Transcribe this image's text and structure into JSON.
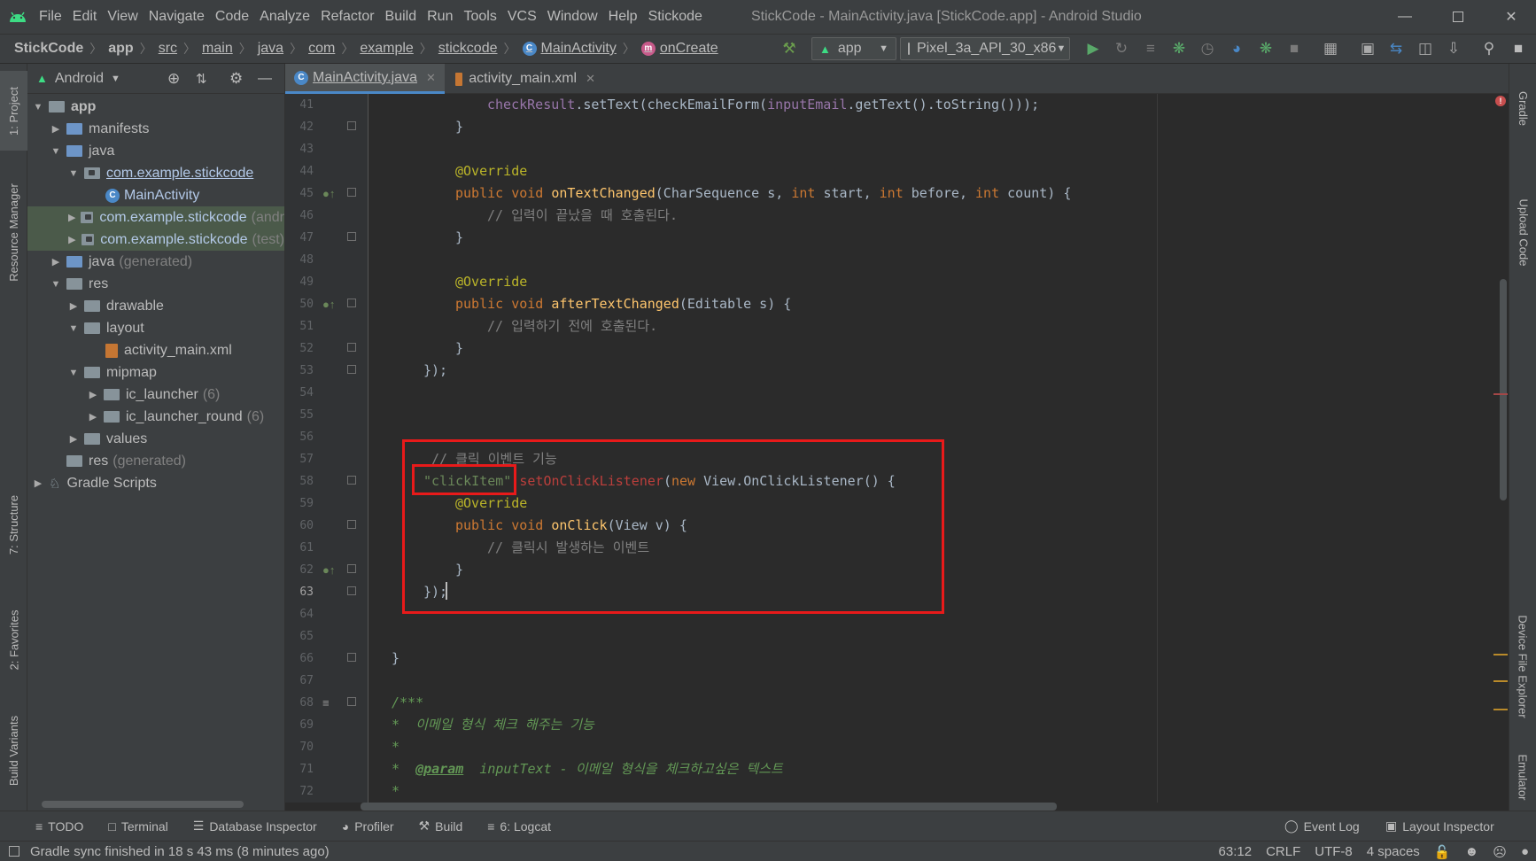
{
  "menubar": {
    "items": [
      "File",
      "Edit",
      "View",
      "Navigate",
      "Code",
      "Analyze",
      "Refactor",
      "Build",
      "Run",
      "Tools",
      "VCS",
      "Window",
      "Help",
      "Stickode"
    ],
    "window_title": "StickCode - MainActivity.java [StickCode.app] - Android Studio"
  },
  "breadcrumb": {
    "items": [
      "StickCode",
      "app",
      "src",
      "main",
      "java",
      "com",
      "example",
      "stickcode",
      "MainActivity",
      "onCreate"
    ]
  },
  "toolbar": {
    "run_config": "app",
    "device": "Pixel_3a_API_30_x86"
  },
  "project_panel": {
    "view_mode": "Android",
    "tree": [
      {
        "label": "app",
        "extra": ""
      },
      {
        "label": "manifests",
        "extra": ""
      },
      {
        "label": "java",
        "extra": ""
      },
      {
        "label": "com.example.stickcode",
        "extra": ""
      },
      {
        "label": "MainActivity",
        "extra": ""
      },
      {
        "label": "com.example.stickcode",
        "extra": "(andr"
      },
      {
        "label": "com.example.stickcode",
        "extra": "(test)"
      },
      {
        "label": "java",
        "extra": "(generated)"
      },
      {
        "label": "res",
        "extra": ""
      },
      {
        "label": "drawable",
        "extra": ""
      },
      {
        "label": "layout",
        "extra": ""
      },
      {
        "label": "activity_main.xml",
        "extra": ""
      },
      {
        "label": "mipmap",
        "extra": ""
      },
      {
        "label": "ic_launcher",
        "extra": "(6)"
      },
      {
        "label": "ic_launcher_round",
        "extra": "(6)"
      },
      {
        "label": "values",
        "extra": ""
      },
      {
        "label": "res",
        "extra": "(generated)"
      },
      {
        "label": "Gradle Scripts",
        "extra": ""
      }
    ]
  },
  "editor_tabs": [
    {
      "label": "MainActivity.java",
      "active": true
    },
    {
      "label": "activity_main.xml",
      "active": false
    }
  ],
  "editor": {
    "line_numbers": [
      "41",
      "42",
      "43",
      "44",
      "45",
      "46",
      "47",
      "48",
      "49",
      "50",
      "51",
      "52",
      "53",
      "54",
      "55",
      "56",
      "57",
      "58",
      "59",
      "60",
      "61",
      "62",
      "63",
      "64",
      "65",
      "66",
      "67",
      "68",
      "69",
      "70",
      "71",
      "72"
    ],
    "current_line": "63",
    "code": {
      "l41_a": "checkResult",
      "l41_b": ".setText(checkEmailForm(",
      "l41_c": "inputEmail",
      "l41_d": ".getText().toString()));",
      "l42": "}",
      "l44": "@Override",
      "l45_kw": "public void ",
      "l45_fn": "onTextChanged",
      "l45_a": "(CharSequence s, ",
      "l45_kw2": "int ",
      "l45_b": "start, ",
      "l45_kw3": "int ",
      "l45_c": "before, ",
      "l45_kw4": "int ",
      "l45_d": "count) {",
      "l46": "// 입력이 끝났을 때 호출된다.",
      "l47": "}",
      "l49": "@Override",
      "l50_kw": "public void ",
      "l50_fn": "afterTextChanged",
      "l50_a": "(Editable s) {",
      "l51": "// 입력하기 전에 호출된다.",
      "l52": "}",
      "l53": "});",
      "l57": "// 클릭 이벤트 기능",
      "l58_str": "\"clickItem\"",
      "l58_err": ".setOnClickListener",
      "l58_a": "(",
      "l58_kw": "new ",
      "l58_b": "View.OnClickListener() {",
      "l59": "@Override",
      "l60_kw": "public void ",
      "l60_fn": "onClick",
      "l60_a": "(View v) {",
      "l61": "// 클릭시 발생하는 이벤트",
      "l62": "}",
      "l63": "});",
      "l66": "}",
      "l68": "/***",
      "l69": "*  이메일 형식 체크 해주는 기능",
      "l70": "*",
      "l71_a": "*  ",
      "l71_tag": "@param",
      "l71_b": "  inputText - 이메일 형식을 체크하고싶은 텍스트",
      "l72": "*"
    }
  },
  "left_tool_tabs": [
    "1: Project",
    "Resource Manager",
    "7: Structure",
    "2: Favorites",
    "Build Variants"
  ],
  "right_tool_tabs": [
    "Gradle",
    "Upload Code",
    "Device File Explorer",
    "Emulator"
  ],
  "bottom_tools": [
    "TODO",
    "Terminal",
    "Database Inspector",
    "Profiler",
    "Build",
    "6: Logcat"
  ],
  "bottom_tools_right": [
    "Event Log",
    "Layout Inspector"
  ],
  "status": {
    "message": "Gradle sync finished in 18 s 43 ms (8 minutes ago)",
    "position": "63:12",
    "line_sep": "CRLF",
    "encoding": "UTF-8",
    "indent": "4 spaces"
  },
  "colors": {
    "keyword": "#cc7832",
    "annotation": "#bbb529",
    "method": "#ffc66d",
    "comment": "#808080",
    "string": "#6a8759",
    "field": "#9876aa",
    "error": "#bc3f3c",
    "highlight": "#e81a1a"
  }
}
